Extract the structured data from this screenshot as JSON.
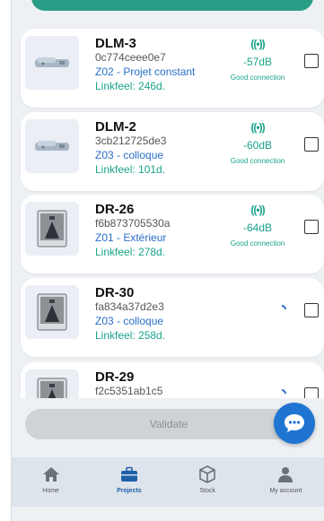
{
  "devices": [
    {
      "name": "DLM-3",
      "id": "0c774ceee0e7",
      "zone": "Z02 - Projet constant",
      "linkfeel": "Linkfeel: 246d.",
      "signal_db": "-57dB",
      "connection": "Good connection",
      "thumb": "dlm-device",
      "state": "connected"
    },
    {
      "name": "DLM-2",
      "id": "3cb212725de3",
      "zone": "Z03 - colloque",
      "linkfeel": "Linkfeel: 101d.",
      "signal_db": "-60dB",
      "connection": "Good connection",
      "thumb": "dlm-device",
      "state": "connected"
    },
    {
      "name": "DR-26",
      "id": "f6b873705530a",
      "zone": "Z01 - Extérieur",
      "linkfeel": "Linkfeel: 278d.",
      "signal_db": "-64dB",
      "connection": "Good connection",
      "thumb": "dr-device",
      "state": "connected"
    },
    {
      "name": "DR-30",
      "id": "fa834a37d2e3",
      "zone": "Z03 - colloque",
      "linkfeel": "Linkfeel: 258d.",
      "signal_db": "",
      "connection": "",
      "thumb": "dr-device",
      "state": "loading"
    },
    {
      "name": "DR-29",
      "id": "f2c5351ab1c5",
      "zone": "",
      "linkfeel": "",
      "signal_db": "",
      "connection": "",
      "thumb": "dr-device",
      "state": "loading"
    }
  ],
  "validate_label": "Validate",
  "nav": [
    {
      "label": "Home",
      "icon": "home-icon",
      "active": false
    },
    {
      "label": "Projects",
      "icon": "briefcase-icon",
      "active": true
    },
    {
      "label": "Stock",
      "icon": "box-icon",
      "active": false
    },
    {
      "label": "My account",
      "icon": "person-icon",
      "active": false
    }
  ],
  "colors": {
    "accent": "#1aa38a",
    "zone_blue": "#2a6fc9",
    "fab": "#1f74d1",
    "nav_active": "#1f5fa8"
  }
}
